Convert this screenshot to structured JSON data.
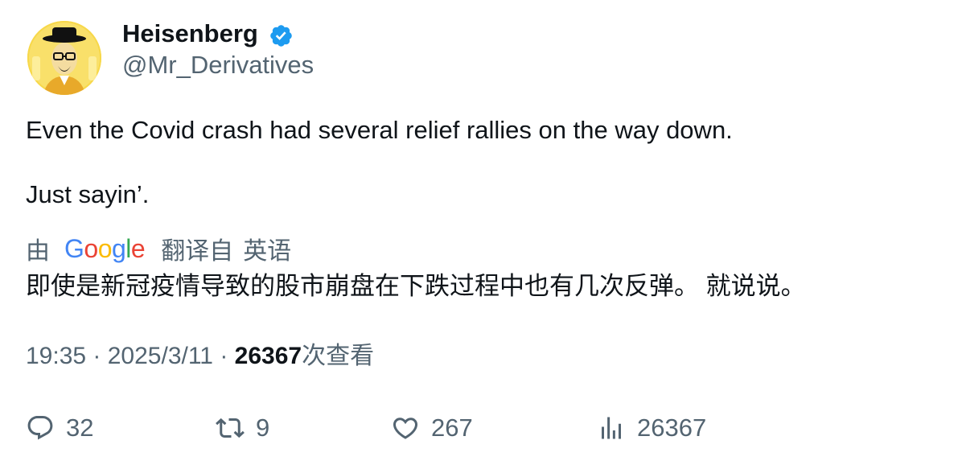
{
  "author": {
    "display_name": "Heisenberg",
    "handle": "@Mr_Derivatives",
    "verified": true
  },
  "tweet": {
    "lines": [
      "Even the Covid crash had several relief rallies on the way down.",
      "Just sayin’."
    ]
  },
  "translation": {
    "prefix": "由",
    "provider": "Google",
    "translated_from_label": "翻译自",
    "source_language": "英语",
    "text": "即使是新冠疫情导致的股市崩盘在下跌过程中也有几次反弹。 就说说。"
  },
  "meta": {
    "time": "19:35",
    "separator": "·",
    "date": "2025/3/11",
    "views": "26367",
    "views_suffix": "次查看"
  },
  "actions": {
    "replies": "32",
    "retweets": "9",
    "likes": "267",
    "views": "26367"
  },
  "colors": {
    "text_primary": "#0f1419",
    "text_secondary": "#536471",
    "verified_blue": "#1d9bf0",
    "avatar_yellow": "#f7d84a"
  }
}
